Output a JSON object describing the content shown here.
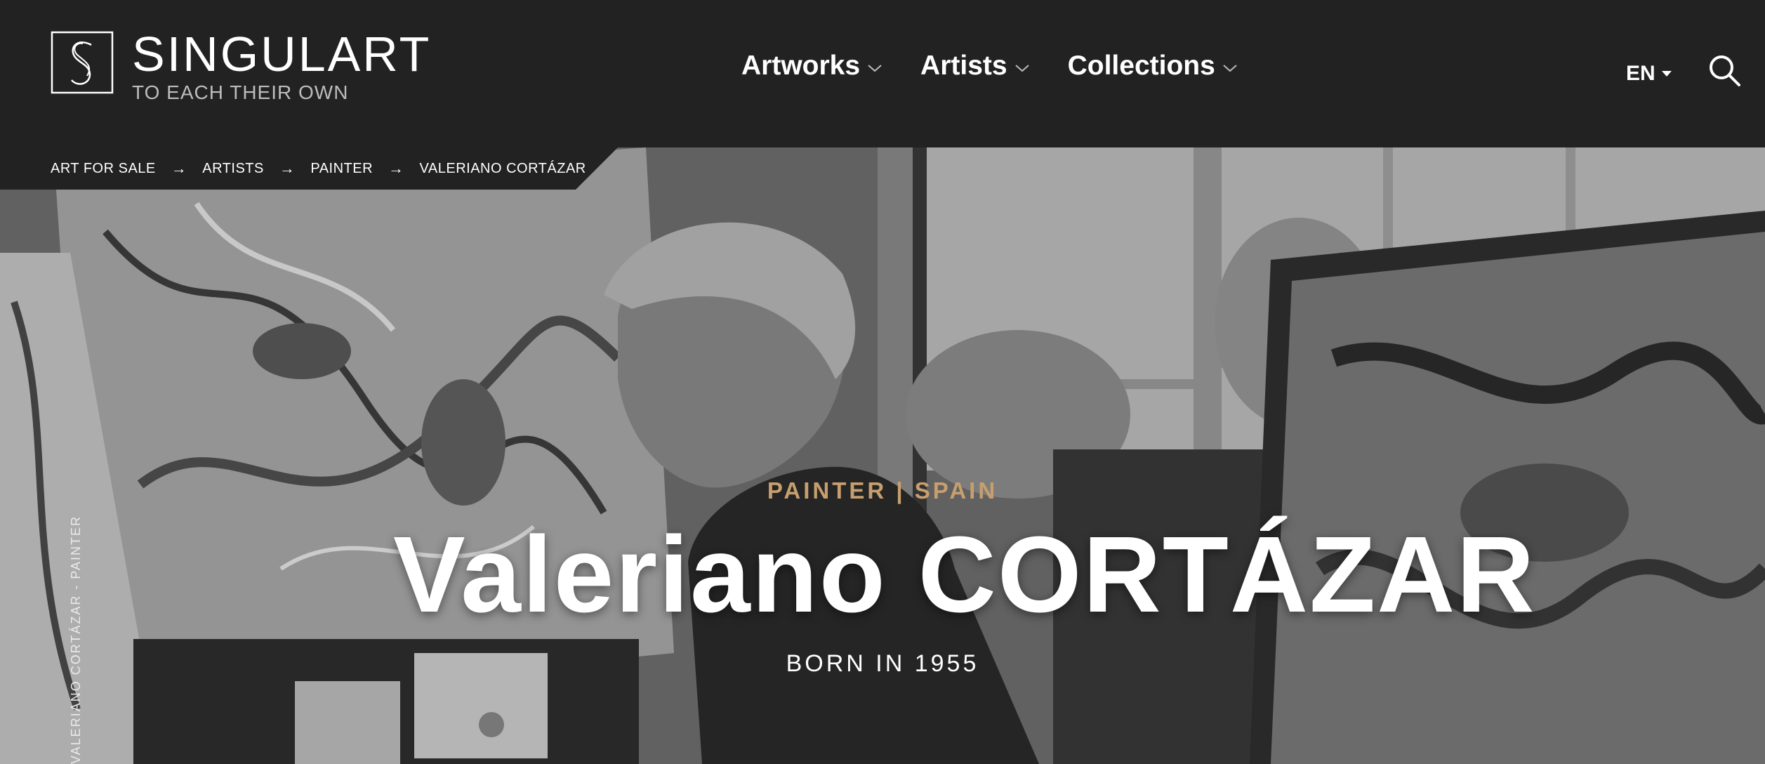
{
  "header": {
    "logo": {
      "name": "SINGULART",
      "tagline": "TO EACH THEIR OWN"
    },
    "nav": [
      {
        "label": "Artworks"
      },
      {
        "label": "Artists"
      },
      {
        "label": "Collections"
      }
    ],
    "language": "EN"
  },
  "breadcrumb": {
    "items": [
      "ART FOR SALE",
      "ARTISTS",
      "PAINTER"
    ],
    "current": "VALERIANO CORTÁZAR",
    "separator": "→"
  },
  "hero": {
    "subtitle": "PAINTER | SPAIN",
    "artist_name": "Valeriano CORTÁZAR",
    "born": "BORN IN 1955",
    "vertical_label": "VALERIANO CORTÁZAR - PAINTER",
    "photo_description_icon": "artist-studio-photo"
  },
  "colors": {
    "header_bg": "#222222",
    "accent": "#c79f6e",
    "text": "#ffffff"
  }
}
